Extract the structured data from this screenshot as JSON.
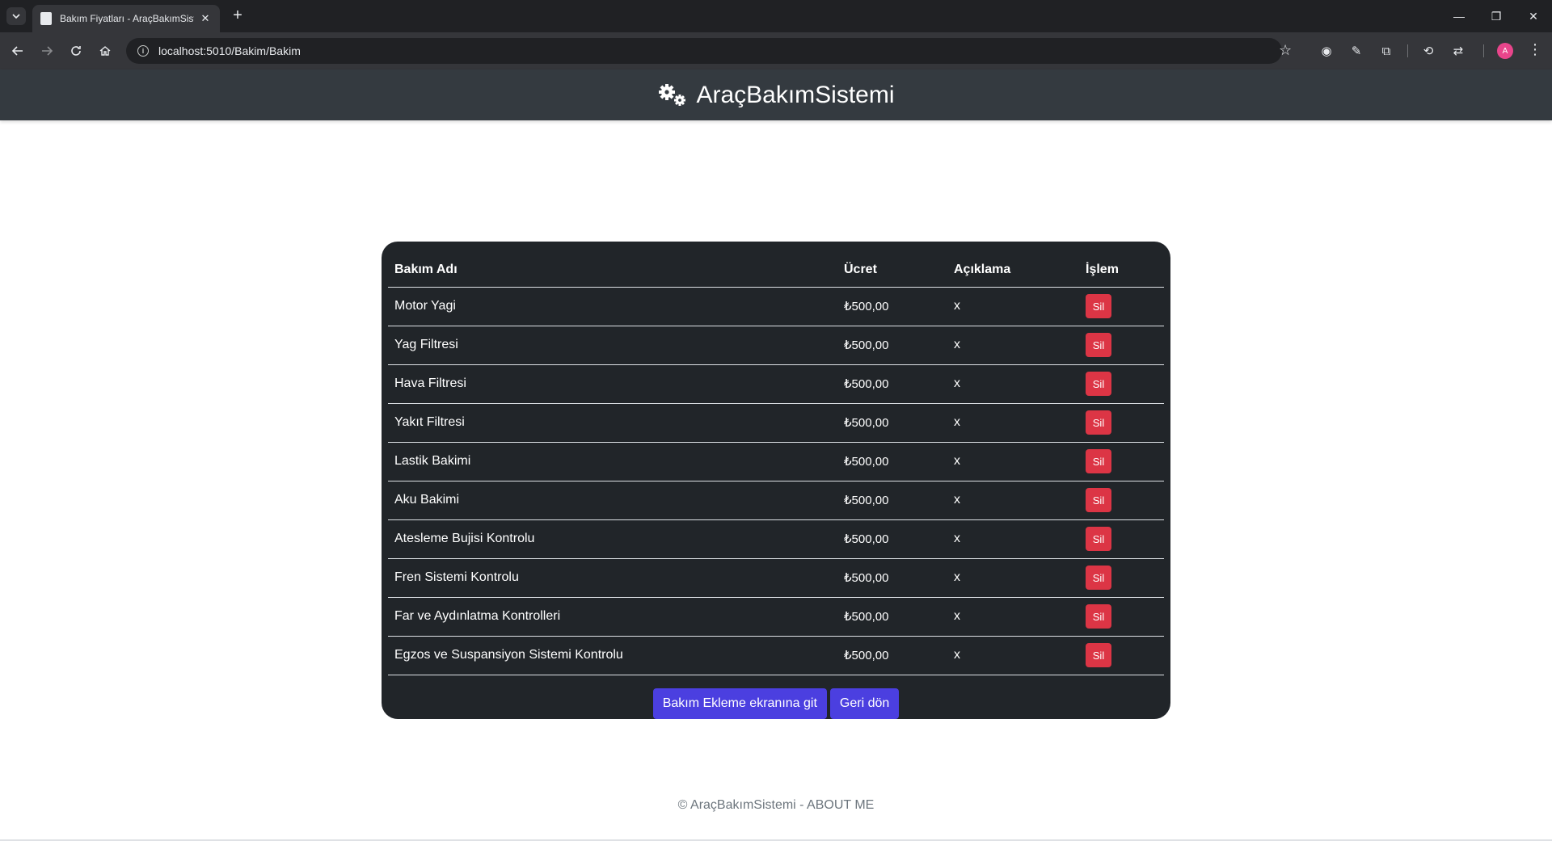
{
  "browser": {
    "tab_title": "Bakım Fiyatları - AraçBakımSistemi",
    "url": "localhost:5010/Bakim/Bakim",
    "avatar_letter": "A"
  },
  "header": {
    "brand": "AraçBakımSistemi"
  },
  "table": {
    "columns": [
      "Bakım Adı",
      "Ücret",
      "Açıklama",
      "İşlem"
    ],
    "rows": [
      {
        "name": "Motor Yagi",
        "price": "₺500,00",
        "desc": "x",
        "action": "Sil"
      },
      {
        "name": "Yag Filtresi",
        "price": "₺500,00",
        "desc": "x",
        "action": "Sil"
      },
      {
        "name": "Hava Filtresi",
        "price": "₺500,00",
        "desc": "x",
        "action": "Sil"
      },
      {
        "name": "Yakıt Filtresi",
        "price": "₺500,00",
        "desc": "x",
        "action": "Sil"
      },
      {
        "name": "Lastik Bakimi",
        "price": "₺500,00",
        "desc": "x",
        "action": "Sil"
      },
      {
        "name": "Aku Bakimi",
        "price": "₺500,00",
        "desc": "x",
        "action": "Sil"
      },
      {
        "name": "Atesleme Bujisi Kontrolu",
        "price": "₺500,00",
        "desc": "x",
        "action": "Sil"
      },
      {
        "name": "Fren Sistemi Kontrolu",
        "price": "₺500,00",
        "desc": "x",
        "action": "Sil"
      },
      {
        "name": "Far ve Aydınlatma Kontrolleri",
        "price": "₺500,00",
        "desc": "x",
        "action": "Sil"
      },
      {
        "name": "Egzos ve Suspansiyon Sistemi Kontrolu",
        "price": "₺500,00",
        "desc": "x",
        "action": "Sil"
      }
    ]
  },
  "buttons": {
    "add": "Bakım Ekleme ekranına git",
    "back": "Geri dön"
  },
  "footer": {
    "text": "© AraçBakımSistemi - ABOUT ME"
  },
  "colors": {
    "header_bg": "#343a40",
    "card_bg": "#212529",
    "delete_button": "#dc3545",
    "primary_button": "#4b3fe0"
  }
}
